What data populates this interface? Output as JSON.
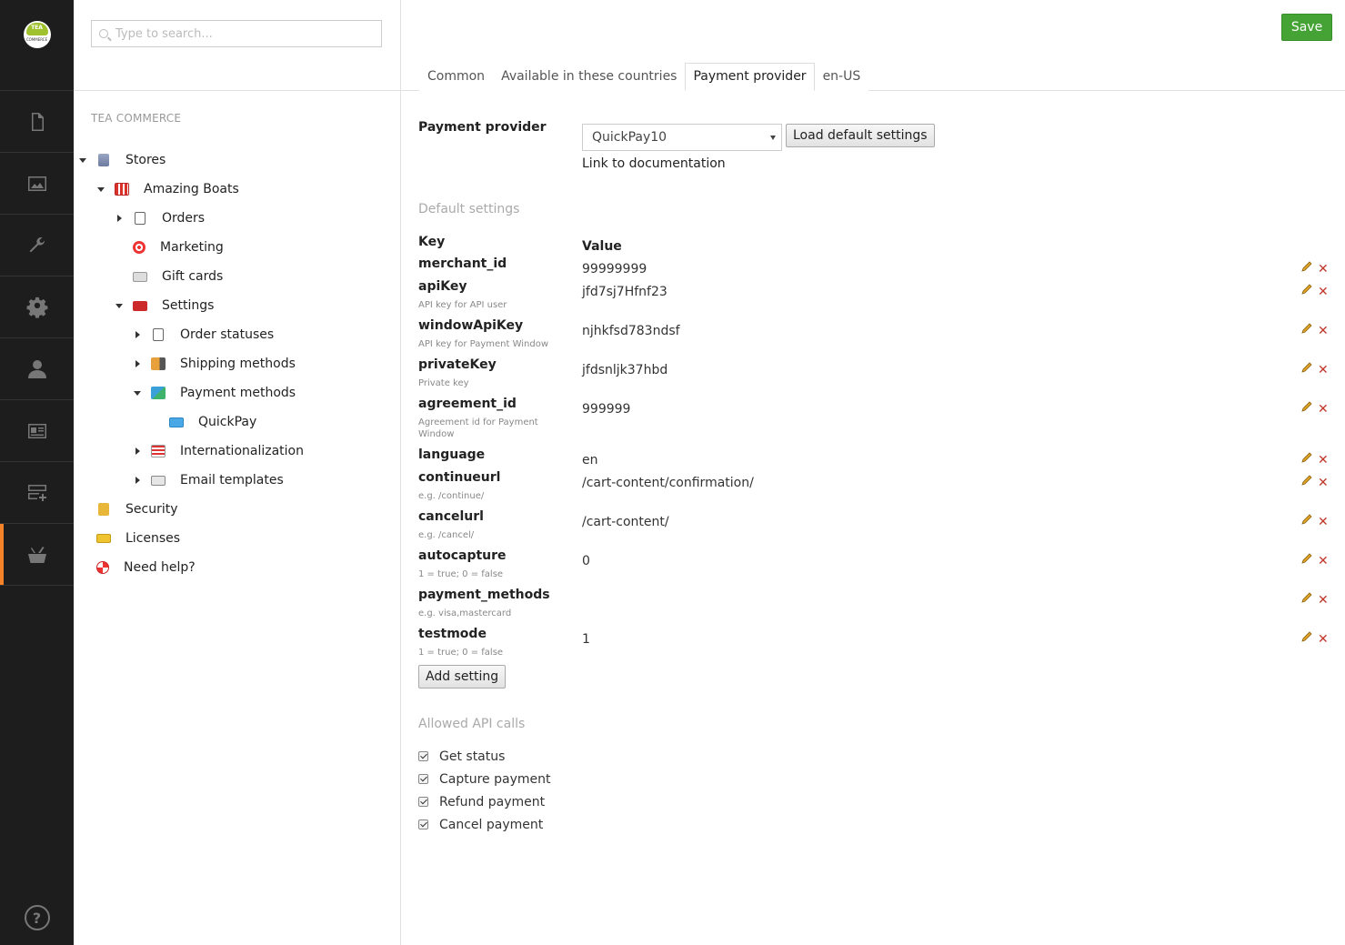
{
  "logo": {
    "line1": "TEA",
    "line2": "COMMERCE"
  },
  "rail": {
    "items": [
      {
        "icon": "document-icon"
      },
      {
        "icon": "image-icon"
      },
      {
        "icon": "wrench-icon"
      },
      {
        "icon": "gear-icon"
      },
      {
        "icon": "user-icon"
      },
      {
        "icon": "id-card-icon"
      },
      {
        "icon": "server-add-icon"
      },
      {
        "icon": "basket-icon",
        "active": true
      }
    ],
    "help_label": "?"
  },
  "search": {
    "placeholder": "Type to search..."
  },
  "tree": {
    "section_title": "TEA COMMERCE",
    "nodes": [
      {
        "label": "Stores"
      },
      {
        "label": "Amazing Boats"
      },
      {
        "label": "Orders"
      },
      {
        "label": "Marketing"
      },
      {
        "label": "Gift cards"
      },
      {
        "label": "Settings"
      },
      {
        "label": "Order statuses"
      },
      {
        "label": "Shipping methods"
      },
      {
        "label": "Payment methods"
      },
      {
        "label": "QuickPay"
      },
      {
        "label": "Internationalization"
      },
      {
        "label": "Email templates"
      },
      {
        "label": "Security"
      },
      {
        "label": "Licenses"
      },
      {
        "label": "Need help?"
      }
    ]
  },
  "header": {
    "save_label": "Save",
    "tabs": [
      {
        "label": "Common"
      },
      {
        "label": "Available in these countries"
      },
      {
        "label": "Payment provider",
        "active": true
      },
      {
        "label": "en-US"
      }
    ]
  },
  "payment_provider": {
    "label": "Payment provider",
    "selected": "QuickPay10",
    "load_defaults_label": "Load default settings",
    "doc_link_label": "Link to documentation"
  },
  "default_settings": {
    "title": "Default settings",
    "key_header": "Key",
    "value_header": "Value",
    "rows": [
      {
        "key": "merchant_id",
        "desc": "",
        "value": "99999999"
      },
      {
        "key": "apiKey",
        "desc": "API key for API user",
        "value": "jfd7sj7Hfnf23"
      },
      {
        "key": "windowApiKey",
        "desc": "API key for Payment Window",
        "value": "njhkfsd783ndsf"
      },
      {
        "key": "privateKey",
        "desc": "Private key",
        "value": "jfdsnljk37hbd"
      },
      {
        "key": "agreement_id",
        "desc": "Agreement id for Payment Window",
        "value": "999999"
      },
      {
        "key": "language",
        "desc": "",
        "value": "en"
      },
      {
        "key": "continueurl",
        "desc": "e.g. /continue/",
        "value": "/cart-content/confirmation/"
      },
      {
        "key": "cancelurl",
        "desc": "e.g. /cancel/",
        "value": "/cart-content/"
      },
      {
        "key": "autocapture",
        "desc": "1 = true; 0 = false",
        "value": "0"
      },
      {
        "key": "payment_methods",
        "desc": "e.g. visa,mastercard",
        "value": ""
      },
      {
        "key": "testmode",
        "desc": "1 = true; 0 = false",
        "value": "1"
      }
    ],
    "add_label": "Add setting"
  },
  "api_calls": {
    "title": "Allowed API calls",
    "items": [
      {
        "label": "Get status",
        "checked": true
      },
      {
        "label": "Capture payment",
        "checked": true
      },
      {
        "label": "Refund payment",
        "checked": true
      },
      {
        "label": "Cancel payment",
        "checked": true
      }
    ]
  },
  "colors": {
    "accent": "#f5832a",
    "save": "#45a335",
    "delete": "#c0392b",
    "rail": "#1d1d1d"
  }
}
